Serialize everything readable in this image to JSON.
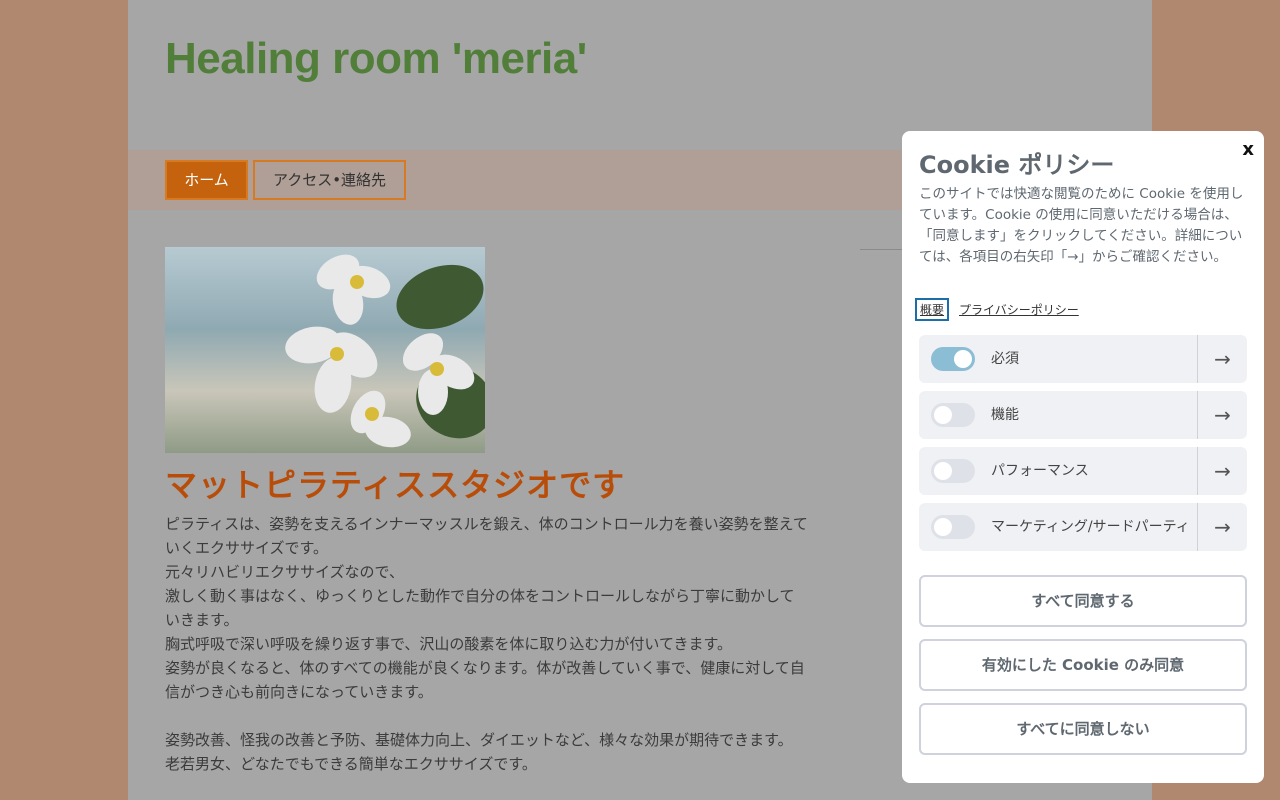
{
  "site": {
    "title": "Healing room 'meria'",
    "nav": [
      {
        "label": "ホーム"
      },
      {
        "label": "アクセス•連絡先"
      }
    ]
  },
  "main": {
    "heading": "マットピラティススタジオです",
    "paragraphs": [
      "ピラティスは、姿勢を支えるインナーマッスルを鍛え、体のコントロール力を養い姿勢を整えていくエクササイズです。",
      "元々リハビリエクササイズなので、",
      "激しく動く事はなく、ゆっくりとした動作で自分の体をコントロールしながら丁寧に動かしていきます。",
      "胸式呼吸で深い呼吸を繰り返す事で、沢山の酸素を体に取り込む力が付いてきます。",
      "姿勢が良くなると、体のすべての機能が良くなります。体が改善していく事で、健康に対して自信がつき心も前向きになっていきます。",
      "姿勢改善、怪我の改善と予防、基礎体力向上、ダイエットなど、様々な効果が期待できます。",
      "老若男女、どなたでもできる簡単なエクササイズです。"
    ]
  },
  "cookie": {
    "close": "x",
    "title": "Cookie ポリシー",
    "description": "このサイトでは快適な閲覧のために Cookie を使用しています。Cookie の使用に同意いただける場合は、「同意します」をクリックしてください。詳細については、各項目の右矢印「→」からご確認ください。",
    "links": {
      "overview": "概要",
      "privacy": "プライバシーポリシー"
    },
    "categories": [
      {
        "label": "必須",
        "enabled": true,
        "arrow": "→"
      },
      {
        "label": "機能",
        "enabled": false,
        "arrow": "→"
      },
      {
        "label": "パフォーマンス",
        "enabled": false,
        "arrow": "→"
      },
      {
        "label": "マーケティング/サードパーティ",
        "enabled": false,
        "arrow": "→"
      }
    ],
    "buttons": {
      "accept_all": "すべて同意する",
      "accept_selected": "有効にした Cookie のみ同意",
      "reject_all": "すべてに同意しない"
    },
    "colors": {
      "toggle_on": "#8bbdd4",
      "toggle_off": "#dfe1e9"
    }
  },
  "colors": {
    "title_green": "#517f3a",
    "accent_orange": "#c5620e",
    "heading_orange": "#b84d0a"
  }
}
